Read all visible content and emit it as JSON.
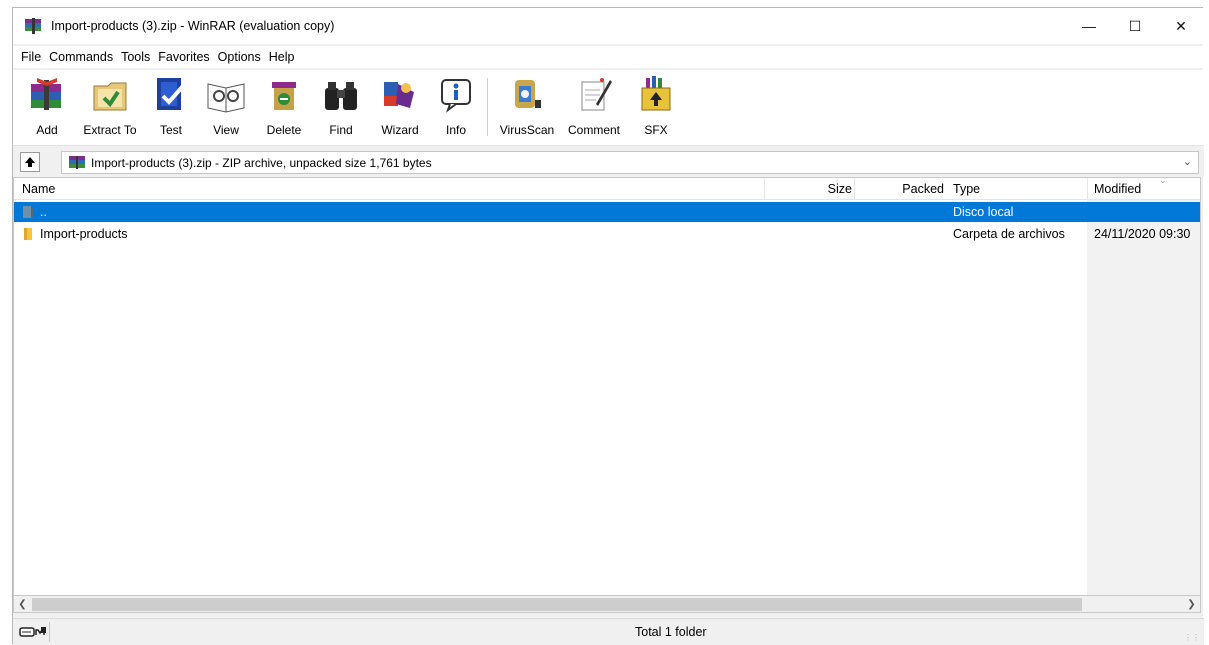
{
  "window": {
    "title": "Import-products (3).zip - WinRAR (evaluation copy)",
    "controls": {
      "minimize": "—",
      "maximize": "☐",
      "close": "✕"
    }
  },
  "menu": [
    "File",
    "Commands",
    "Tools",
    "Favorites",
    "Options",
    "Help"
  ],
  "toolbar": {
    "tools": [
      {
        "label": "Add",
        "icon": "add-archive-icon"
      },
      {
        "label": "Extract To",
        "icon": "extract-to-icon"
      },
      {
        "label": "Test",
        "icon": "test-icon"
      },
      {
        "label": "View",
        "icon": "view-icon"
      },
      {
        "label": "Delete",
        "icon": "delete-icon"
      },
      {
        "label": "Find",
        "icon": "find-binoculars-icon"
      },
      {
        "label": "Wizard",
        "icon": "wizard-icon"
      },
      {
        "label": "Info",
        "icon": "info-icon"
      },
      {
        "label": "VirusScan",
        "icon": "virusscan-icon"
      },
      {
        "label": "Comment",
        "icon": "comment-icon"
      },
      {
        "label": "SFX",
        "icon": "sfx-icon"
      }
    ]
  },
  "address": {
    "path": "Import-products (3).zip - ZIP archive, unpacked size 1,761 bytes"
  },
  "list": {
    "columns": {
      "name": "Name",
      "size": "Size",
      "packed": "Packed",
      "type": "Type",
      "modified": "Modified"
    },
    "rows": [
      {
        "name": "..",
        "size": "",
        "packed": "",
        "type": "Disco local",
        "modified": "",
        "selected": true
      },
      {
        "name": "Import-products",
        "size": "",
        "packed": "",
        "type": "Carpeta de archivos",
        "modified": "24/11/2020 09:30",
        "selected": false
      }
    ]
  },
  "status": {
    "text": "Total 1 folder"
  },
  "colors": {
    "selection": "#0078d7",
    "folder": "#f4c542"
  }
}
